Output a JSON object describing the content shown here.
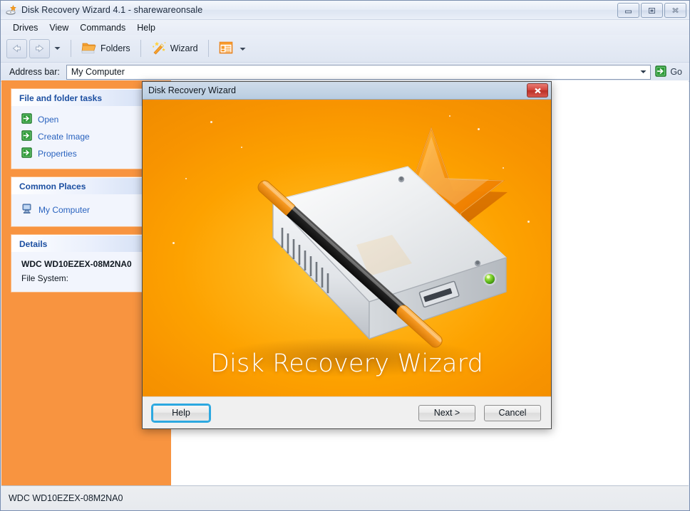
{
  "window": {
    "title": "Disk Recovery Wizard 4.1 - sharewareonsale",
    "icon": "disk-wizard-icon",
    "controls": {
      "minimize": "minimize-icon",
      "maximize": "maximize-icon",
      "close": "close-icon"
    }
  },
  "menubar": {
    "items": [
      "Drives",
      "View",
      "Commands",
      "Help"
    ]
  },
  "toolbar": {
    "back": "back-arrow-icon",
    "forward": "forward-arrow-icon",
    "history_caret": "chevron-down-icon",
    "folders_label": "Folders",
    "folders_icon": "folder-icon",
    "wizard_label": "Wizard",
    "wizard_icon": "magic-wand-icon",
    "views_icon": "views-list-icon",
    "views_caret": "chevron-down-icon"
  },
  "address": {
    "label": "Address bar:",
    "value": "My Computer",
    "placeholder": "My Computer",
    "caret": "chevron-down-icon",
    "go_label": "Go",
    "go_icon": "green-arrow-icon"
  },
  "sidebar": {
    "panels": [
      {
        "title": "File and folder tasks",
        "items": [
          {
            "label": "Open",
            "icon": "green-arrow-icon"
          },
          {
            "label": "Create Image",
            "icon": "green-arrow-icon"
          },
          {
            "label": "Properties",
            "icon": "green-arrow-icon"
          }
        ]
      },
      {
        "title": "Common Places",
        "items": [
          {
            "label": "My Computer",
            "icon": "my-computer-icon"
          }
        ]
      },
      {
        "title": "Details",
        "lines": [
          {
            "text": "WDC WD10EZEX-08M2NA0",
            "strong": true
          },
          {
            "text": "File System:",
            "strong": false
          }
        ]
      }
    ]
  },
  "statusbar": {
    "text": "WDC WD10EZEX-08M2NA0"
  },
  "dialog": {
    "title": "Disk Recovery Wizard",
    "close_icon": "close-icon",
    "splash_title": "Disk Recovery Wizard",
    "splash_art": "hard-drive-star-wand-illustration",
    "buttons": {
      "help": "Help",
      "next": "Next >",
      "cancel": "Cancel"
    }
  },
  "colors": {
    "accent_orange": "#f89440",
    "splash_orange": "#fda200",
    "link_blue": "#2a63bf",
    "panel_title_blue": "#1c4fa1",
    "focus_blue": "#2ca8e0",
    "close_red": "#d2453c",
    "green_icon": "#2e9b37"
  }
}
